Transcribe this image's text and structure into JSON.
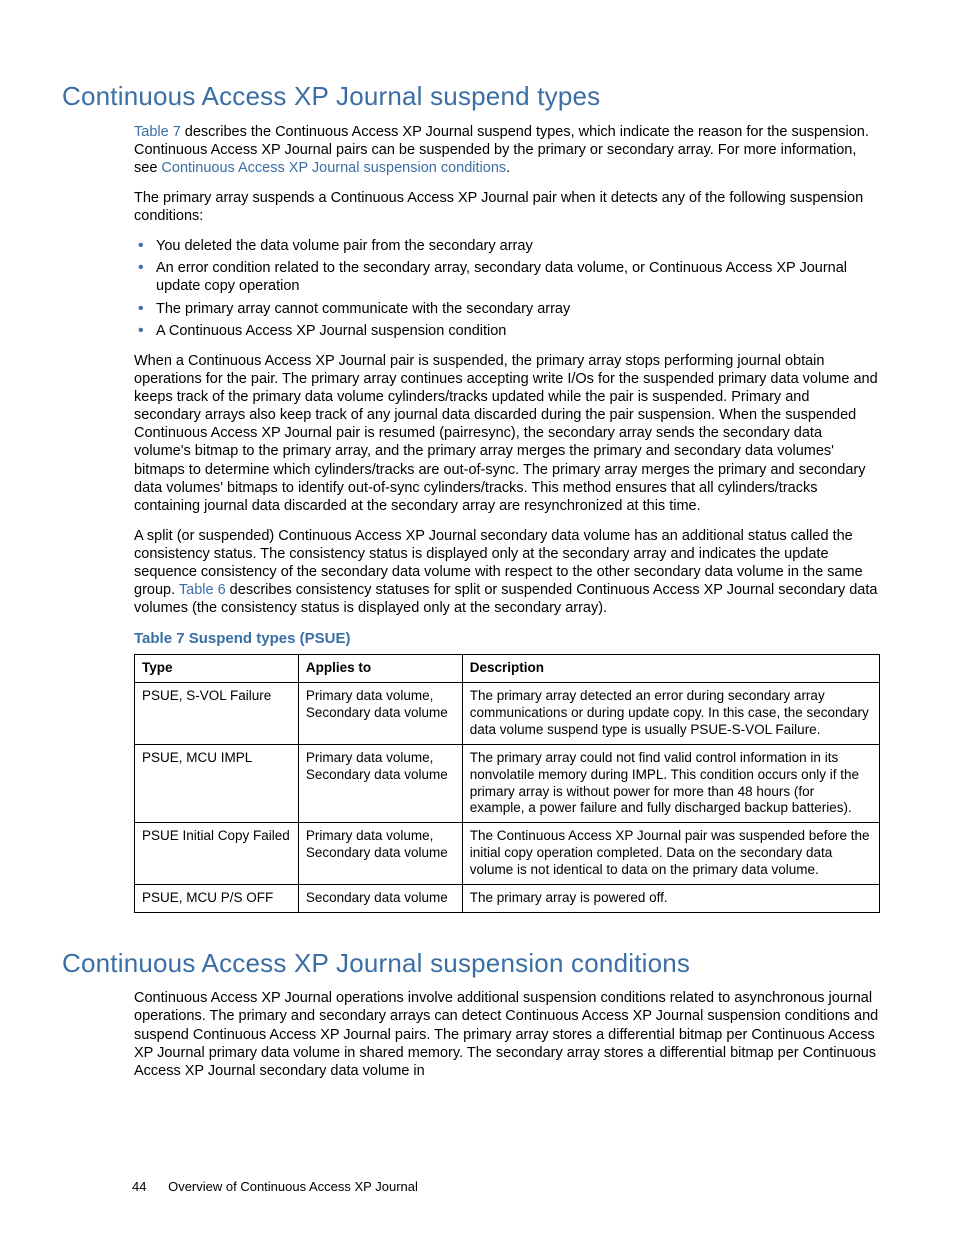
{
  "section1": {
    "title": "Continuous Access XP Journal suspend types",
    "p1a": " describes the Continuous Access XP Journal suspend types, which indicate the reason for the suspension. Continuous Access XP Journal pairs can be suspended by the primary or secondary array. For more information, see ",
    "p1b": ".",
    "xref_table7": "Table 7",
    "xref_suspconds": "Continuous Access XP Journal suspension conditions",
    "p2": "The primary array suspends a Continuous Access XP Journal pair when it detects any of the following suspension conditions:",
    "bullets": {
      "b1": "You deleted the data volume pair from the secondary array",
      "b2": "An error condition related to the secondary array, secondary data volume, or Continuous Access XP Journal update copy operation",
      "b3": "The primary array cannot communicate with the secondary array",
      "b4": "A Continuous Access XP Journal suspension condition"
    },
    "p3": "When a Continuous Access XP Journal pair is suspended, the primary array stops performing journal obtain operations for the pair. The primary array continues accepting write I/Os for the suspended primary data volume and keeps track of the primary data volume cylinders/tracks updated while the pair is suspended. Primary and secondary arrays also keep track of any journal data discarded during the pair suspension. When the suspended Continuous Access XP Journal pair is resumed (pairresync), the secondary array sends the secondary data volume's bitmap to the primary array, and the primary array merges the primary and secondary data volumes' bitmaps to determine which cylinders/tracks are out-of-sync. The primary array merges the primary and secondary data volumes' bitmaps to identify out-of-sync cylinders/tracks. This method ensures that all cylinders/tracks containing journal data discarded at the secondary array are resynchronized at this time.",
    "p4a": "A split (or suspended) Continuous Access XP Journal secondary data volume has an additional status called the consistency status. The consistency status is displayed only at the secondary array and indicates the update sequence consistency of the secondary data volume with respect to the other secondary data volume in the same group. ",
    "xref_table6": "Table 6",
    "p4b": " describes consistency statuses for split or suspended Continuous Access XP Journal secondary data volumes (the consistency status is displayed only at the secondary array)."
  },
  "table7": {
    "caption": "Table 7 Suspend types (PSUE)",
    "headers": {
      "c1": "Type",
      "c2": "Applies to",
      "c3": "Description"
    },
    "rows": {
      "r1": {
        "c1": "PSUE, S-VOL Failure",
        "c2": "Primary data volume, Secondary data volume",
        "c3": "The primary array detected an error during secondary array communications or during update copy. In this case, the secondary data volume suspend type is usually PSUE-S-VOL Failure."
      },
      "r2": {
        "c1": "PSUE, MCU IMPL",
        "c2": "Primary data volume, Secondary data volume",
        "c3": "The primary array could not find valid control information in its nonvolatile memory during IMPL. This condition occurs only if the primary array is without power for more than 48 hours (for example, a power failure and fully discharged backup batteries)."
      },
      "r3": {
        "c1": "PSUE Initial Copy Failed",
        "c2": "Primary data volume, Secondary data volume",
        "c3": "The Continuous Access XP Journal pair was suspended before the initial copy operation completed. Data on the secondary data volume is not identical to data on the primary data volume."
      },
      "r4": {
        "c1": "PSUE, MCU P/S OFF",
        "c2": "Secondary data volume",
        "c3": "The primary array is powered off."
      }
    }
  },
  "section2": {
    "title": "Continuous Access XP Journal suspension conditions",
    "p1": "Continuous Access XP Journal operations involve additional suspension conditions related to asynchronous journal operations. The primary and secondary arrays can detect Continuous Access XP Journal suspension conditions and suspend Continuous Access XP Journal pairs. The primary array stores a differential bitmap per Continuous Access XP Journal primary data volume in shared memory. The secondary array stores a differential bitmap per Continuous Access XP Journal secondary data volume in"
  },
  "footer": {
    "page": "44",
    "chapter": "Overview of Continuous Access XP Journal"
  }
}
